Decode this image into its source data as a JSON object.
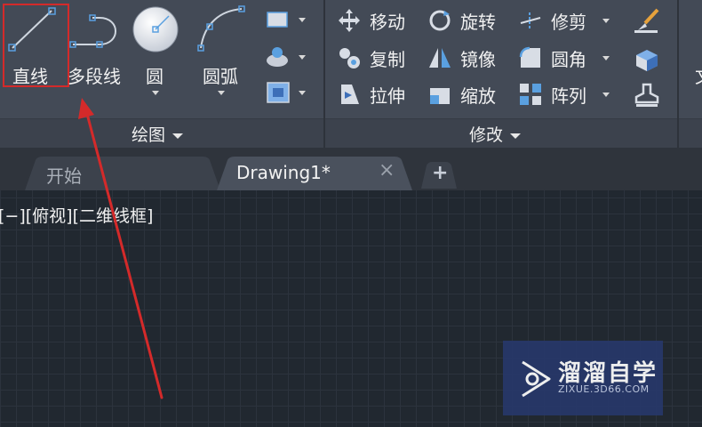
{
  "ribbon": {
    "draw_panel": {
      "title": "绘图",
      "tools": [
        {
          "label": "直线",
          "icon": "line-icon"
        },
        {
          "label": "多段线",
          "icon": "polyline-icon"
        },
        {
          "label": "圆",
          "icon": "circle-icon"
        },
        {
          "label": "圆弧",
          "icon": "arc-icon"
        }
      ],
      "small_tools": [
        "rectangle-icon",
        "hatch-icon",
        "region-icon"
      ]
    },
    "modify_panel": {
      "title": "修改",
      "items": [
        {
          "label": "移动",
          "icon": "move-icon"
        },
        {
          "label": "旋转",
          "icon": "rotate-icon"
        },
        {
          "label": "修剪",
          "icon": "trim-icon"
        },
        {
          "label": "复制",
          "icon": "copy-icon"
        },
        {
          "label": "镜像",
          "icon": "mirror-icon"
        },
        {
          "label": "圆角",
          "icon": "fillet-icon"
        },
        {
          "label": "拉伸",
          "icon": "stretch-icon"
        },
        {
          "label": "缩放",
          "icon": "scale-icon"
        },
        {
          "label": "阵列",
          "icon": "array-icon"
        }
      ],
      "extra_icons": [
        "match-properties-icon",
        "solid-icon",
        "stamp-icon"
      ]
    },
    "clipped_next_label": "文"
  },
  "tabs": {
    "start": "开始",
    "drawing": "Drawing1*",
    "close_glyph": "×",
    "add_glyph": "+"
  },
  "viewport": {
    "label": "[−][俯视][二维线框]"
  },
  "watermark": {
    "title": "溜溜自学",
    "subtitle": "ZIXUE.3D66.COM"
  },
  "colors": {
    "ribbon_bg": "#434a56",
    "canvas_bg": "#212830",
    "highlight": "#d42a2a",
    "annotation_arrow": "#d42a2a",
    "icon_accent": "#5aa0e0"
  }
}
